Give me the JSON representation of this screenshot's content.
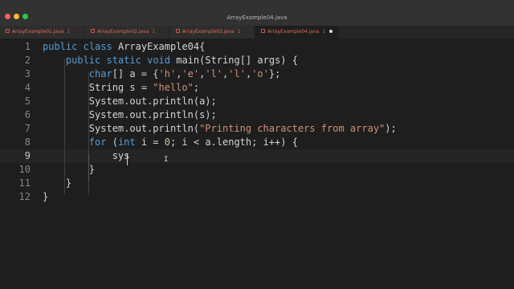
{
  "window": {
    "title": "ArrayExample04.java"
  },
  "tabs": [
    {
      "label": "ArrayExample01.java",
      "count": "1",
      "active": false
    },
    {
      "label": "ArrayExample02.java",
      "count": "1",
      "active": false
    },
    {
      "label": "ArrayExample03.java",
      "count": "1",
      "active": false
    },
    {
      "label": "ArrayExample04.java",
      "count": "1",
      "active": true
    }
  ],
  "editor": {
    "current_line": "9",
    "lines": [
      {
        "number": "1",
        "text": "public class ArrayExample04{"
      },
      {
        "number": "2",
        "text": "    public static void main(String[] args) {"
      },
      {
        "number": "3",
        "text": "        char[] a = {'h','e','l','l','o'};"
      },
      {
        "number": "4",
        "text": "        String s = \"hello\";"
      },
      {
        "number": "5",
        "text": "        System.out.println(a);"
      },
      {
        "number": "6",
        "text": "        System.out.println(s);"
      },
      {
        "number": "7",
        "text": "        System.out.println(\"Printing characters from array\");"
      },
      {
        "number": "8",
        "text": "        for (int i = 0; i < a.length; i++) {"
      },
      {
        "number": "9",
        "text": "            sys"
      },
      {
        "number": "10",
        "text": "        }"
      },
      {
        "number": "11",
        "text": "    }"
      },
      {
        "number": "12",
        "text": "}"
      }
    ]
  },
  "colors": {
    "keyword": "#569cd6",
    "string": "#ce9178",
    "tab_error": "#e8695a",
    "background": "#1e1e1e"
  }
}
